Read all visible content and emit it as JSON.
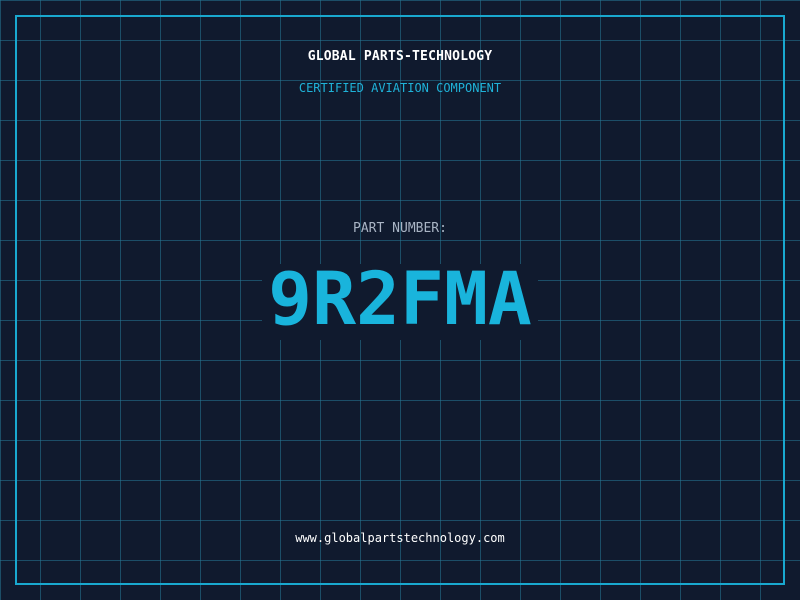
{
  "header": {
    "company": "GLOBAL PARTS-TECHNOLOGY",
    "subtitle": "CERTIFIED AVIATION COMPONENT"
  },
  "part": {
    "label": "PART NUMBER:",
    "number": "9R2FMA"
  },
  "footer": {
    "website": "www.globalpartstechnology.com"
  },
  "colors": {
    "background": "#101a2e",
    "grid": "#26789a",
    "accent": "#19b4dc",
    "text": "#ffffff",
    "label": "#a9b4c4"
  }
}
